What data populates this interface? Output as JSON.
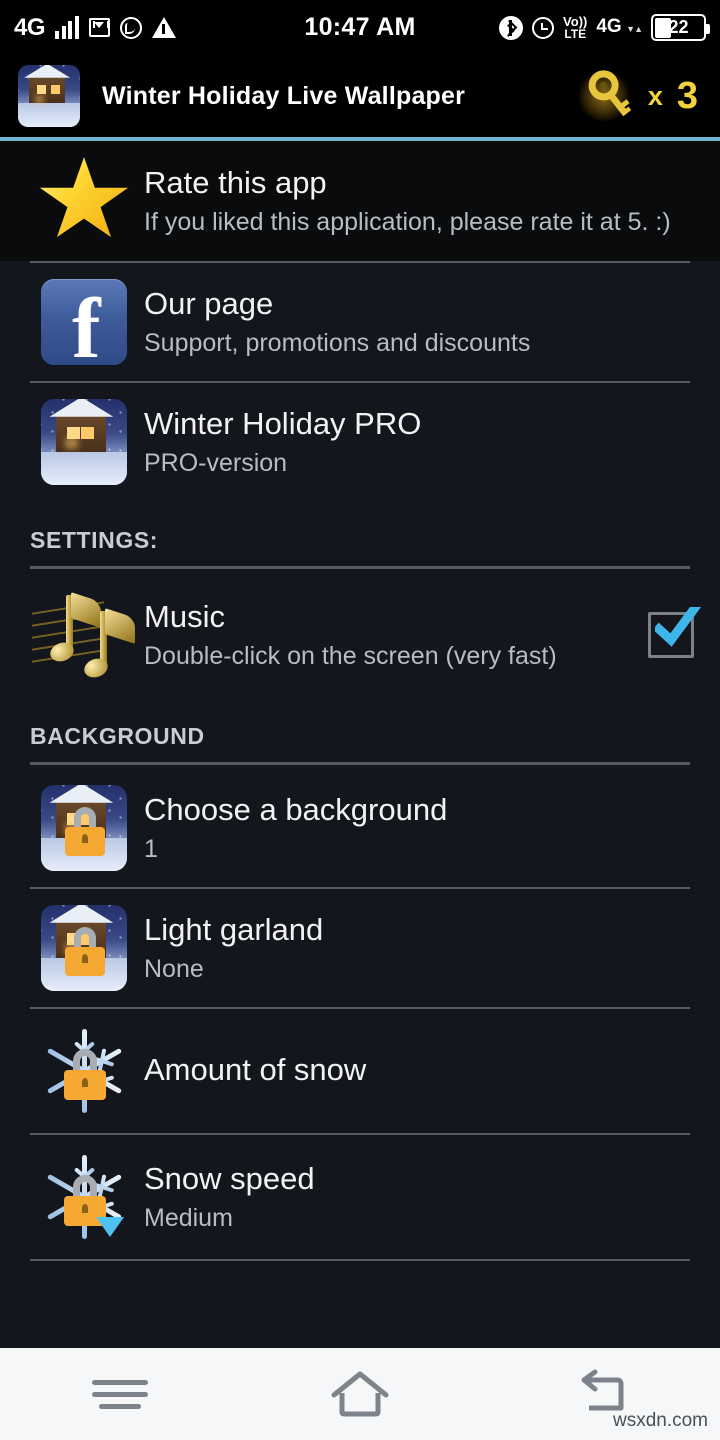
{
  "status_bar": {
    "network_left": "4G",
    "time": "10:47 AM",
    "volte_top": "Vo))",
    "volte_bottom": "LTE",
    "network_right": "4G",
    "battery_percent": "22",
    "icons": [
      "signal-bars-icon",
      "mail-icon",
      "whatsapp-icon",
      "warning-icon",
      "bluetooth-icon",
      "alarm-icon",
      "volte-icon",
      "battery-icon"
    ]
  },
  "app_bar": {
    "title": "Winter Holiday Live Wallpaper",
    "app_icon": "winter-cabin-thumbnail",
    "key_icon": "key-icon",
    "key_multiplier": "x",
    "key_count": "3",
    "accent_color": "#6fb4d0",
    "key_color": "#f5d33a"
  },
  "rows": [
    {
      "name": "rate-this-app",
      "icon": "star-icon",
      "title": "Rate this app",
      "subtitle": "If you liked this application, please rate it at 5. :)"
    },
    {
      "name": "our-page",
      "icon": "facebook-icon",
      "title": "Our page",
      "subtitle": "Support, promotions and discounts"
    },
    {
      "name": "winter-holiday-pro",
      "icon": "winter-cabin-pro-thumbnail",
      "title": "Winter Holiday PRO",
      "subtitle": "PRO-version"
    }
  ],
  "settings_section": {
    "header": "SETTINGS:",
    "music": {
      "name": "music-setting",
      "icon": "music-notes-icon",
      "title": "Music",
      "subtitle": "Double-click on the screen (very fast)",
      "checkbox": "checked",
      "checkbox_color": "#4ec1f0"
    }
  },
  "background_section": {
    "header": "BACKGROUND",
    "items": [
      {
        "name": "choose-a-background",
        "icon": "locked-cabin-thumbnail",
        "title": "Choose a background",
        "subtitle": "1",
        "locked": true
      },
      {
        "name": "light-garland",
        "icon": "locked-cabin-garland-thumbnail",
        "title": "Light garland",
        "subtitle": "None",
        "locked": true
      },
      {
        "name": "amount-of-snow",
        "icon": "locked-snowflake-icon",
        "title": "Amount of snow",
        "subtitle": "",
        "locked": true
      },
      {
        "name": "snow-speed",
        "icon": "locked-snowflake-icon",
        "title": "Snow speed",
        "subtitle": "Medium",
        "locked": true
      }
    ]
  },
  "nav_bar": {
    "menu": "menu-icon",
    "home": "home-icon",
    "back": "back-icon"
  },
  "watermark": "wsxdn.com"
}
